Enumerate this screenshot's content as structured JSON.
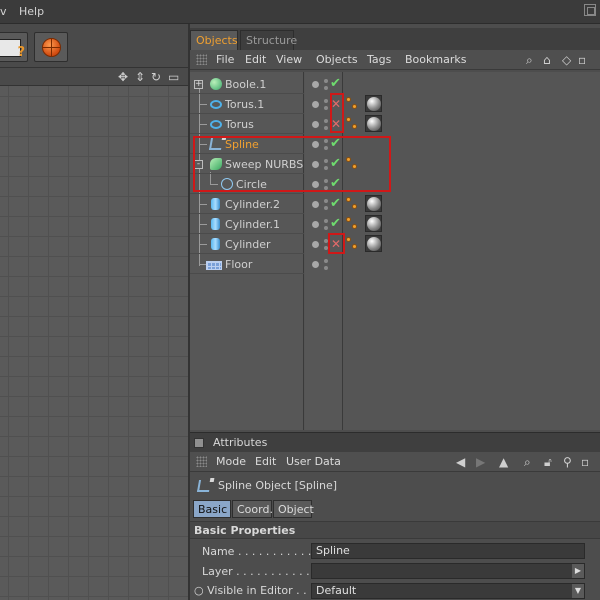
{
  "menubar": {
    "items": [
      "v",
      "Help"
    ]
  },
  "object_manager": {
    "tabs": [
      {
        "label": "Objects",
        "active": true
      },
      {
        "label": "Structure",
        "active": false
      }
    ],
    "menu": [
      "File",
      "Edit",
      "View",
      "Objects",
      "Tags",
      "Bookmarks"
    ],
    "objects": [
      {
        "name": "Boole.1",
        "icon": "boole-icon",
        "expander": "+",
        "state": "check",
        "tags": []
      },
      {
        "name": "Torus.1",
        "icon": "torus-icon",
        "state": "cross",
        "tags": [
          "phong-tag",
          "material-tag"
        ]
      },
      {
        "name": "Torus",
        "icon": "torus-icon",
        "state": "cross",
        "tags": [
          "phong-tag",
          "material-tag"
        ]
      },
      {
        "name": "Spline",
        "icon": "spline-icon",
        "state": "check",
        "highlight": true,
        "tags": []
      },
      {
        "name": "Sweep NURBS",
        "icon": "sweep-icon",
        "expander": "-",
        "state": "check",
        "tags": [
          "phong-tag"
        ]
      },
      {
        "name": "Circle",
        "icon": "circle-icon",
        "state": "check",
        "tags": []
      },
      {
        "name": "Cylinder.2",
        "icon": "cylinder-icon",
        "state": "check",
        "tags": [
          "phong-tag",
          "material-tag"
        ]
      },
      {
        "name": "Cylinder.1",
        "icon": "cylinder-icon",
        "state": "check",
        "tags": [
          "phong-tag",
          "material-tag"
        ]
      },
      {
        "name": "Cylinder",
        "icon": "cylinder-icon",
        "state": "cross",
        "tags": [
          "phong-tag",
          "material-tag"
        ]
      },
      {
        "name": "Floor",
        "icon": "floor-icon",
        "state": "none",
        "tags": []
      }
    ]
  },
  "attributes": {
    "title": "Attributes",
    "menu": [
      "Mode",
      "Edit",
      "User Data"
    ],
    "object_label": "Spline Object [Spline]",
    "tabs": [
      {
        "label": "Basic",
        "active": true
      },
      {
        "label": "Coord.",
        "active": false
      },
      {
        "label": "Object",
        "active": false
      }
    ],
    "section_title": "Basic Properties",
    "properties": [
      {
        "label": "Name . . . . . . . . . . . . .",
        "value": "Spline"
      },
      {
        "label": "Layer . . . . . . . . . . . . .",
        "value": ""
      },
      {
        "label": "Visible in Editor . . . .",
        "value": "Default"
      }
    ]
  },
  "colors": {
    "active_tab_text": "#f0a030",
    "highlight_border": "#d01818",
    "check": "#6fdc6f",
    "cross": "#e36a6a"
  }
}
